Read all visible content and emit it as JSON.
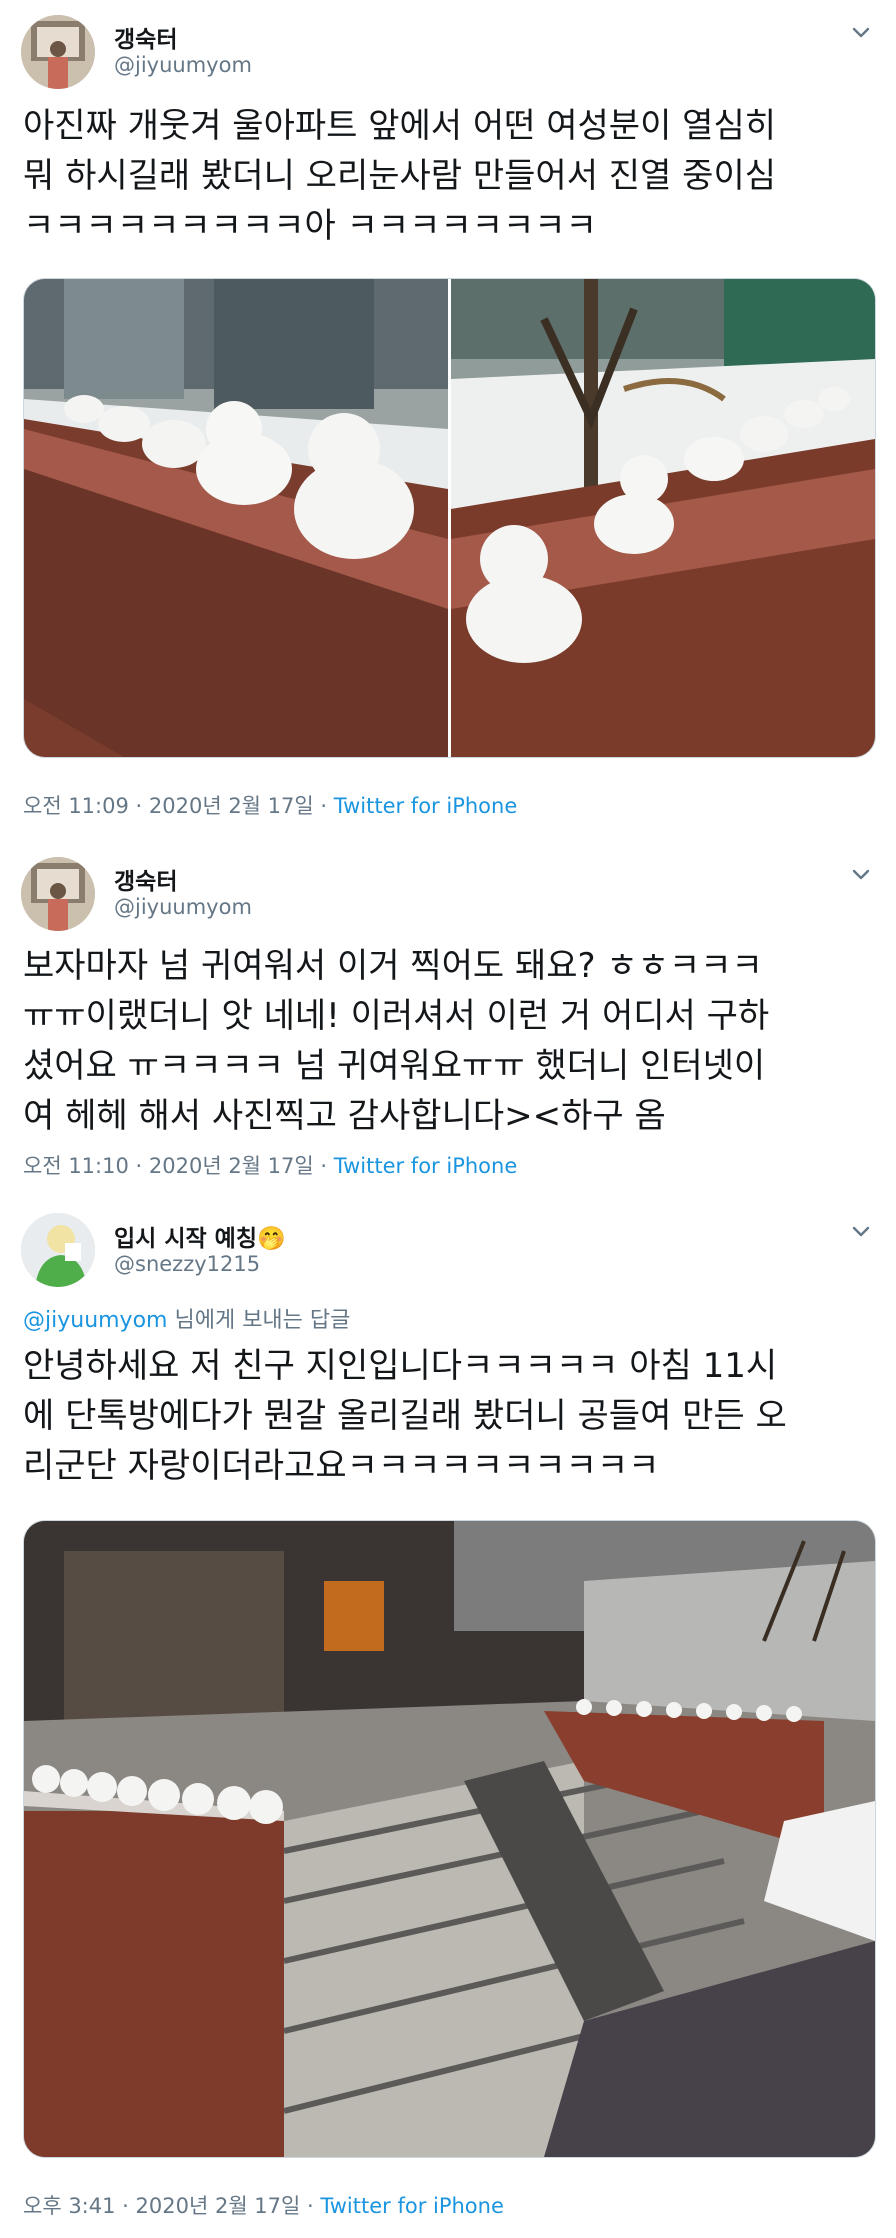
{
  "tweets": [
    {
      "name": "갱숙터",
      "handle": "@jiyuumyom",
      "lines": [
        "아진짜 개웃겨 울아파트 앞에서 어떤 여성분이 열심히",
        "뭐 하시길래 봤더니 오리눈사람 만들어서 진열 중이심",
        "ㅋㅋㅋㅋㅋㅋㅋㅋㅋ아 ㅋㅋㅋㅋㅋㅋㅋㅋ"
      ],
      "time": "오전 11:09",
      "date": "2020년 2월 17일",
      "source": "Twitter for iPhone"
    },
    {
      "name": "갱숙터",
      "handle": "@jiyuumyom",
      "lines": [
        "보자마자 넘 귀여워서 이거 찍어도 돼요? ㅎㅎㅋㅋㅋ",
        "ㅠㅠ이랬더니 앗 네네! 이러셔서 이런 거 어디서 구하",
        "셨어요 ㅠㅋㅋㅋㅋ 넘 귀여워요ㅠㅠ 했더니 인터넷이",
        "여 헤헤 해서 사진찍고 감사합니다><하구 옴"
      ],
      "time": "오전 11:10",
      "date": "2020년 2월 17일",
      "source": "Twitter for iPhone"
    },
    {
      "name": "입시 시작 예칭🤭",
      "handle": "@snezzy1215",
      "reply_to": "@jiyuumyom",
      "reply_suffix": " 님에게 보내는 답글",
      "lines": [
        "안녕하세요 저 친구 지인입니다ㅋㅋㅋㅋㅋ 아침 11시",
        "에 단톡방에다가 뭔갈 올리길래 봤더니 공들여 만든 오",
        "리군단 자랑이더라고요ㅋㅋㅋㅋㅋㅋㅋㅋㅋㅋ"
      ],
      "time": "오후 3:41",
      "date": "2020년 2월 17일",
      "source": "Twitter for iPhone"
    }
  ],
  "meta_separator": " · ",
  "icons": {
    "more": "chevron-down-icon",
    "avatar": "avatar"
  },
  "colors": {
    "link": "#1b95e0",
    "muted": "#657786",
    "text": "#14171a"
  }
}
